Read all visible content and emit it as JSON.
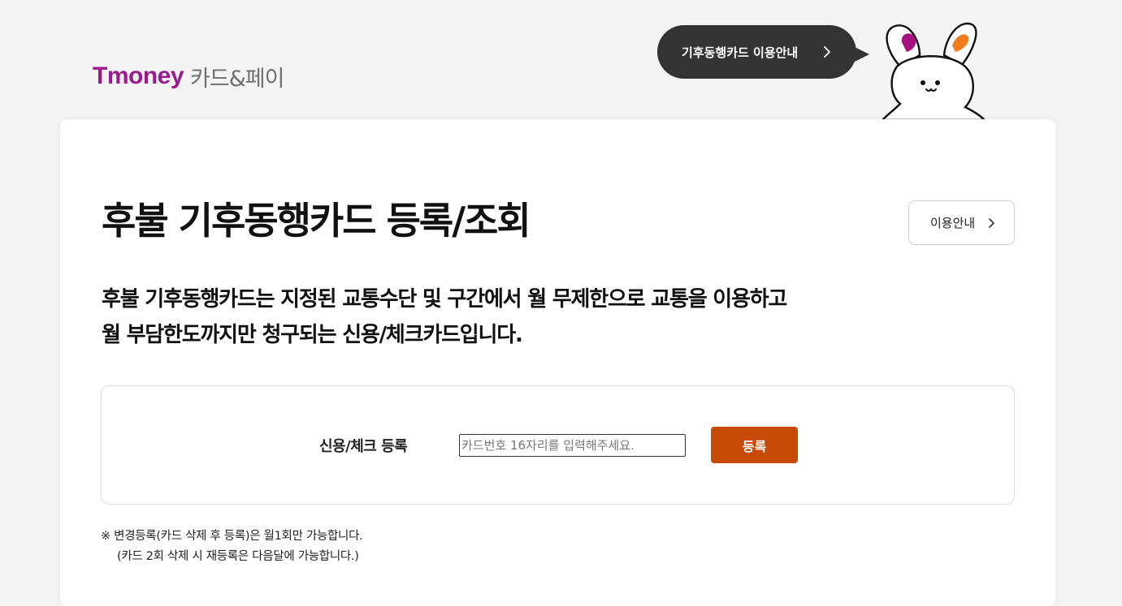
{
  "brand": {
    "logo_main": "Tmoney",
    "logo_sub": "카드&페이",
    "logo_color": "#9b1b8e"
  },
  "top_guide": {
    "label": "기후동행카드 이용안내",
    "icon": "chevron-right-icon"
  },
  "mascot": {
    "icon": "bunny-mascot-icon"
  },
  "main": {
    "title": "후불 기후동행카드 등록/조회",
    "guide_button_label": "이용안내",
    "description_lines": [
      "후불 기후동행카드는 지정된 교통수단 및 구간에서 월 무제한으로 교통을 이용하고",
      "월 부담한도까지만 청구되는 신용/체크카드입니다."
    ]
  },
  "register": {
    "label": "신용/체크 등록",
    "input_value": "",
    "input_placeholder": "카드번호 16자리를 입력해주세요.",
    "button_label": "등록",
    "button_color": "#c94a06"
  },
  "notice": {
    "line1": "※ 변경등록(카드 삭제 후 등록)은 월1회만 가능합니다.",
    "line2": "(카드 2회 삭제 시 재등록은 다음달에 가능합니다.)"
  }
}
